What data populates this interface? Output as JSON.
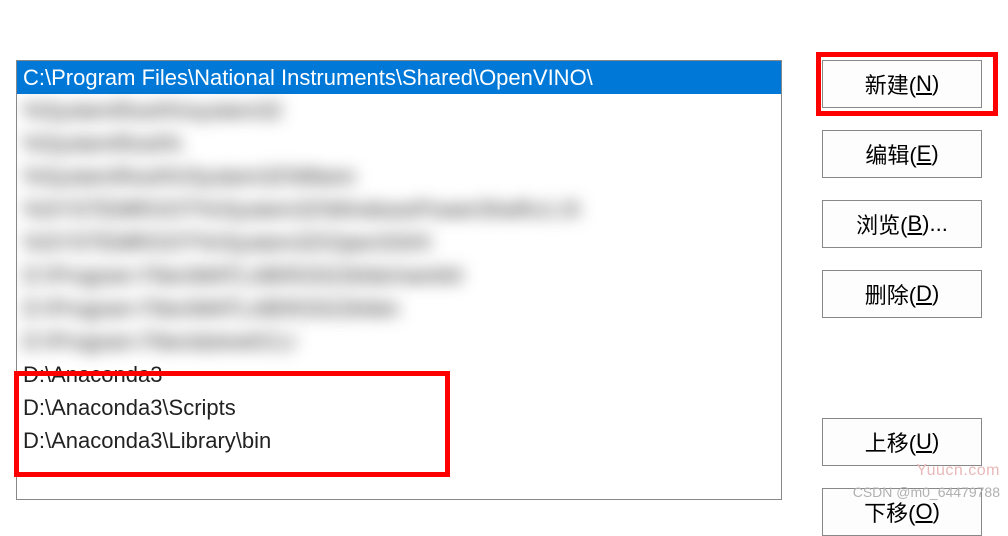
{
  "listbox": {
    "items": [
      {
        "text": "C:\\Program Files\\National Instruments\\Shared\\OpenVINO\\",
        "selected": true,
        "blurred": false
      },
      {
        "text": "%SystemRoot%\\system32",
        "selected": false,
        "blurred": true
      },
      {
        "text": "%SystemRoot%",
        "selected": false,
        "blurred": true
      },
      {
        "text": "%SystemRoot%\\System32\\Wbem",
        "selected": false,
        "blurred": true
      },
      {
        "text": "%SYSTEMROOT%\\System32\\WindowsPowerShell\\v1.0\\",
        "selected": false,
        "blurred": true
      },
      {
        "text": "%SYSTEMROOT%\\System32\\OpenSSH\\",
        "selected": false,
        "blurred": true
      },
      {
        "text": "D:\\Program Files\\MATLAB\\R2022b\\bin\\win64",
        "selected": false,
        "blurred": true
      },
      {
        "text": "D:\\Program Files\\MATLAB\\R2022b\\bin",
        "selected": false,
        "blurred": true
      },
      {
        "text": "D:\\Program Files\\dotnet\\CLI",
        "selected": false,
        "blurred": true
      },
      {
        "text": "D:\\Anaconda3",
        "selected": false,
        "blurred": false
      },
      {
        "text": "D:\\Anaconda3\\Scripts",
        "selected": false,
        "blurred": false
      },
      {
        "text": "D:\\Anaconda3\\Library\\bin",
        "selected": false,
        "blurred": false
      }
    ]
  },
  "buttons": {
    "new": {
      "label": "新建(",
      "mnemonic": "N",
      "tail": ")"
    },
    "edit": {
      "label": "编辑(",
      "mnemonic": "E",
      "tail": ")"
    },
    "browse": {
      "label": "浏览(",
      "mnemonic": "B",
      "tail": ")..."
    },
    "delete": {
      "label": "删除(",
      "mnemonic": "D",
      "tail": ")"
    },
    "moveup": {
      "label": "上移(",
      "mnemonic": "U",
      "tail": ")"
    },
    "movedown": {
      "label": "下移(",
      "mnemonic": "O",
      "tail": ")"
    }
  },
  "watermarks": {
    "site": "Yuucn.com",
    "author": "CSDN @m0_64479788"
  }
}
